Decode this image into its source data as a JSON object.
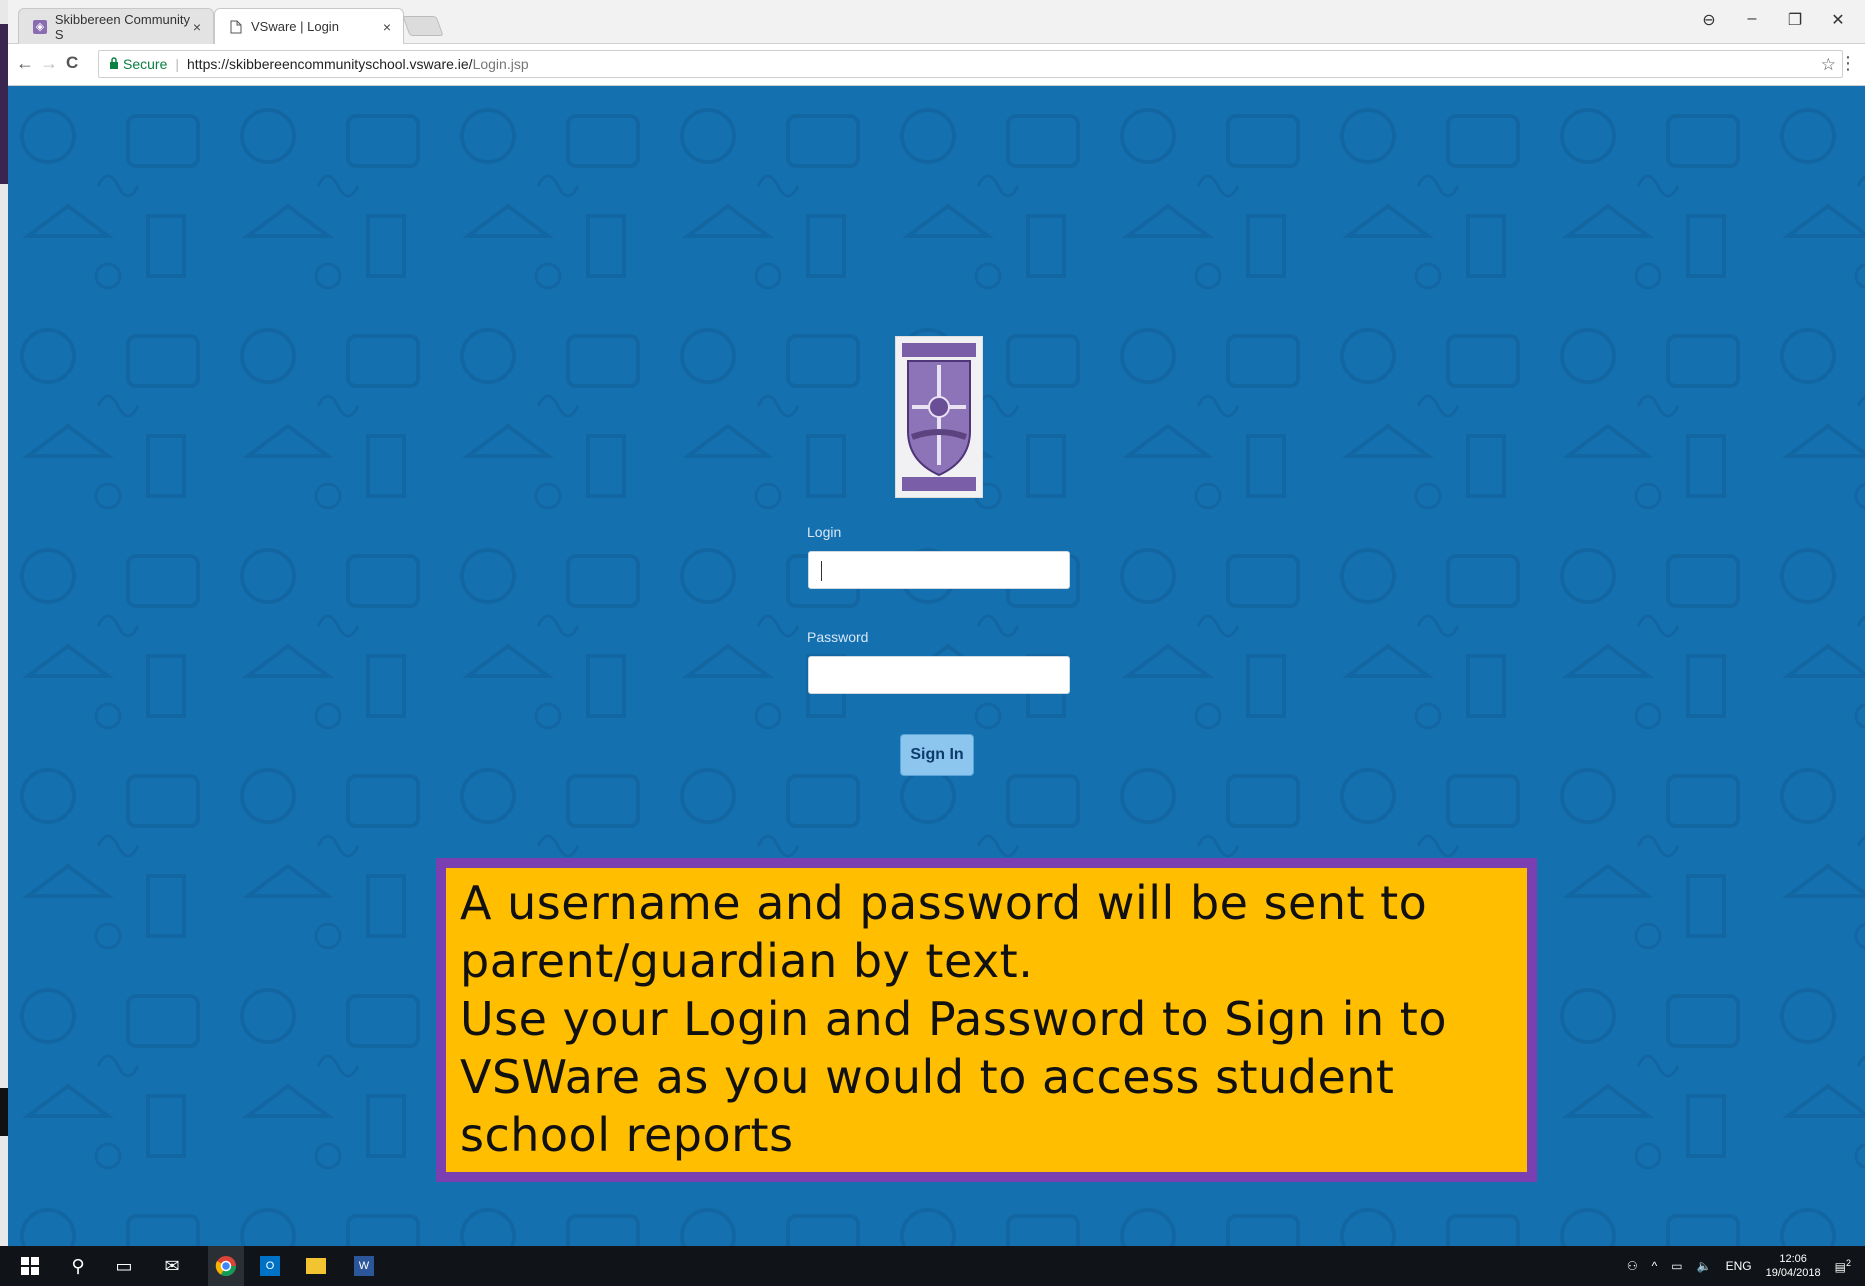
{
  "browser": {
    "tabs": [
      {
        "label": "Skibbereen Community S",
        "close": "×"
      },
      {
        "label": "VSware | Login",
        "close": "×"
      }
    ],
    "window_controls": {
      "profile": "⊖",
      "minimize": "–",
      "restore": "❐",
      "close": "✕"
    },
    "nav": {
      "back": "←",
      "forward": "→",
      "reload": "C"
    },
    "address": {
      "secure_label": "Secure",
      "host": "https://skibbereencommunityschool.vsware.ie/",
      "path": "Login.jsp"
    }
  },
  "login_form": {
    "login_label": "Login",
    "login_value": "",
    "password_label": "Password",
    "password_value": "",
    "submit_label": "Sign In"
  },
  "note": {
    "text": "A username and password will be sent to\nparent/guardian by text.\nUse your Login and Password to Sign in to\nVSWare as you would to access student\nschool reports"
  },
  "taskbar": {
    "tray": {
      "language": "ENG",
      "time": "12:06",
      "date": "19/04/2018",
      "notification_count": "2"
    }
  },
  "colors": {
    "page_bg": "#1570b0",
    "note_bg": "#ffbe00",
    "note_border": "#7a3fb0",
    "button": "#8cc6ef",
    "secure": "#0b8043"
  }
}
